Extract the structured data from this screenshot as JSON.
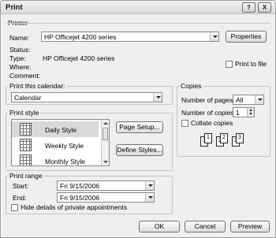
{
  "window": {
    "title": "Print",
    "help_glyph": "?",
    "close_glyph": "X"
  },
  "printer": {
    "legend": "Printer",
    "name_label": "Name:",
    "name_value": "HP Officejet 4200 series",
    "properties_button": "Properties",
    "status_label": "Status:",
    "status_value": "",
    "type_label": "Type:",
    "type_value": "HP Officejet 4200 series",
    "where_label": "Where:",
    "where_value": "",
    "comment_label": "Comment:",
    "comment_value": "",
    "print_to_file_label": "Print to file",
    "print_to_file_checked": false
  },
  "calendar": {
    "legend": "Print this calendar:",
    "value": "Calendar"
  },
  "print_style": {
    "legend": "Print style",
    "items": [
      {
        "label": "Daily Style",
        "selected": true
      },
      {
        "label": "Weekly Style",
        "selected": false
      },
      {
        "label": "Monthly Style",
        "selected": false
      }
    ],
    "page_setup_button": "Page Setup...",
    "define_styles_button": "Define Styles..."
  },
  "copies": {
    "legend": "Copies",
    "number_of_pages_label": "Number of pages:",
    "number_of_pages_value": "All",
    "number_of_copies_label": "Number of copies:",
    "number_of_copies_value": "1",
    "collate_label": "Collate copies",
    "collate_checked": false,
    "collate_pages": [
      "1",
      "1",
      "2",
      "2",
      "3",
      "3"
    ]
  },
  "print_range": {
    "legend": "Print range",
    "start_label": "Start:",
    "start_value": "Fri 9/15/2006",
    "end_label": "End:",
    "end_value": "Fri 9/15/2006",
    "hide_private_label": "Hide details of private appointments",
    "hide_private_checked": false
  },
  "footer": {
    "ok": "OK",
    "cancel": "Cancel",
    "preview": "Preview"
  }
}
